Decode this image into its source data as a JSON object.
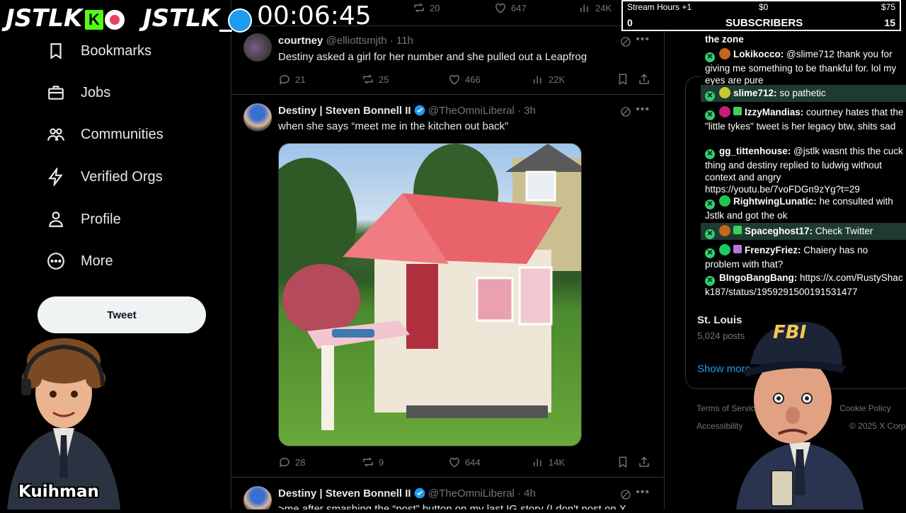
{
  "nav": {
    "items": [
      {
        "label": "Bookmarks",
        "icon": "bookmark-icon"
      },
      {
        "label": "Jobs",
        "icon": "briefcase-icon"
      },
      {
        "label": "Communities",
        "icon": "people-icon"
      },
      {
        "label": "Verified Orgs",
        "icon": "lightning-icon"
      },
      {
        "label": "Profile",
        "icon": "person-icon"
      },
      {
        "label": "More",
        "icon": "more-circle-icon"
      }
    ],
    "tweet_button": "Tweet"
  },
  "top_partial": {
    "reply": "",
    "retweet": "20",
    "like": "647",
    "views": "24K"
  },
  "tweets": [
    {
      "name": "courtney",
      "handle": "@elliottsmjth",
      "time": "· 11h",
      "text": "Destiny asked a girl for her number  and she pulled out a Leapfrog",
      "reply": "21",
      "retweet": "25",
      "like": "466",
      "views": "22K"
    },
    {
      "name": "Destiny | Steven Bonnell II",
      "handle": "@TheOmniLiberal",
      "time": "· 3h",
      "text": "when she says “meet me in the kitchen out back”",
      "reply": "28",
      "retweet": "9",
      "like": "644",
      "views": "14K"
    },
    {
      "name": "Destiny | Steven Bonnell II",
      "handle": "@TheOmniLiberal",
      "time": "· 4h",
      "text": ">me after smashing the “post” button on my last IG story (I don't post on X"
    }
  ],
  "trend": {
    "name": "St. Louis",
    "posts": "5,024 posts",
    "show_more": "Show more"
  },
  "footer": {
    "terms": "Terms of Service",
    "cookie": "Cookie Policy",
    "accessibility": "Accessibility",
    "copyright": "© 2025 X Corp."
  },
  "overlay": {
    "logo1": "JSTLK",
    "logo2": "JSTLK_",
    "timer": "00:06:45",
    "stream_hours": "Stream Hours +1",
    "amount_left": "$0",
    "amount_right": "$75",
    "left_count": "0",
    "subscribers_label": "SUBSCRIBERS",
    "subscribers_count": "15",
    "left_cam_name": "Kuihman",
    "fbi_text": "FBI"
  },
  "chat": {
    "top_line": "the zone",
    "messages": [
      {
        "user": "Lokikocco:",
        "text": "@slime712 thank you for giving me something to be thankful for. lol my eyes are pure",
        "dot": "#c8641e"
      },
      {
        "user": "slime712:",
        "text": "so pathetic",
        "dot": "#c8c832"
      },
      {
        "user": "IzzyMandias:",
        "text": "courtney hates that the \"little tykes\" tweet is her legacy btw, shits sad",
        "dot": "#c81e78"
      },
      {
        "user": "gg_tittenhouse:",
        "text": "@jstlk wasnt this the cuck thing and destiny replied to ludwig without context and angry https://youtu.be/7voFDGn9zYg?t=29",
        "dot": ""
      },
      {
        "user": "RightwingLunatic:",
        "text": "he consulted with Jstlk and got the ok",
        "dot": "#1ec850"
      },
      {
        "user": "Spaceghost17:",
        "text": "Check Twitter",
        "dot": "#c8641e"
      },
      {
        "user": "FrenzyFriez:",
        "text": "Chaiery has no problem with that?",
        "dot": "#1ec864"
      },
      {
        "user": "BIngoBangBang:",
        "text": "https://x.com/RustyShack187/status/1959291500191531477",
        "dot": ""
      }
    ]
  },
  "colors": {
    "accent": "#1d9bf0",
    "chat_badge": "#2ecc71",
    "bg": "#000000"
  }
}
